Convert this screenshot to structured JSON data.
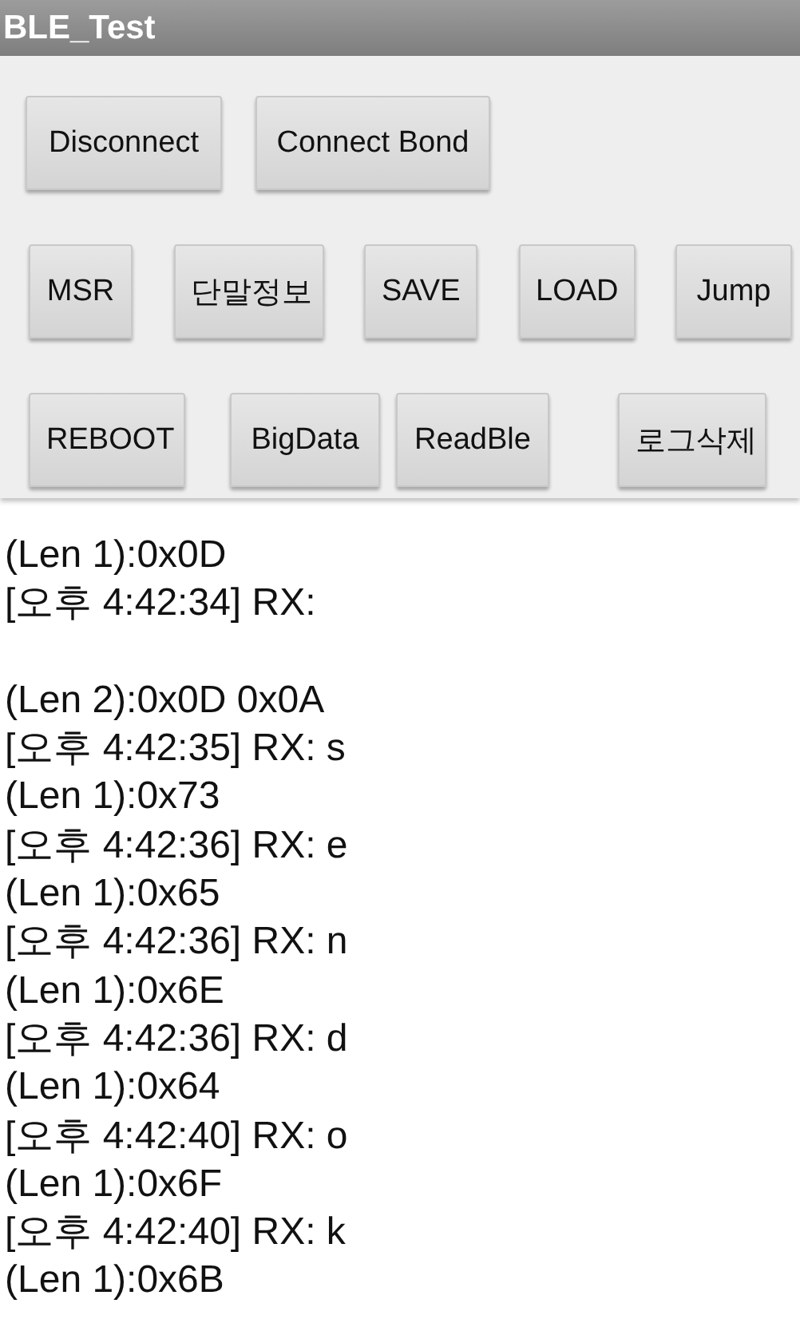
{
  "window": {
    "title": "BLE_Test"
  },
  "button_rows": [
    {
      "buttons": [
        "Disconnect",
        "Connect Bond"
      ]
    },
    {
      "buttons": [
        "MSR",
        "단말정보",
        "SAVE",
        "LOAD",
        "Jump"
      ]
    },
    {
      "buttons": [
        "REBOOT",
        "BigData",
        "ReadBle",
        "로그삭제"
      ]
    }
  ],
  "log_lines": [
    {
      "text": "(Len 1):0x0D",
      "blank_after": false
    },
    {
      "text": "[오후 4:42:34] RX:",
      "blank_after": true
    },
    {
      "text": "(Len 2):0x0D 0x0A",
      "blank_after": false
    },
    {
      "text": "[오후 4:42:35] RX: s",
      "blank_after": false
    },
    {
      "text": "(Len 1):0x73",
      "blank_after": false
    },
    {
      "text": "[오후 4:42:36] RX: e",
      "blank_after": false
    },
    {
      "text": "(Len 1):0x65",
      "blank_after": false
    },
    {
      "text": "[오후 4:42:36] RX: n",
      "blank_after": false
    },
    {
      "text": "(Len 1):0x6E",
      "blank_after": false
    },
    {
      "text": "[오후 4:42:36] RX: d",
      "blank_after": false
    },
    {
      "text": "(Len 1):0x64",
      "blank_after": false
    },
    {
      "text": "[오후 4:42:40] RX: o",
      "blank_after": false
    },
    {
      "text": "(Len 1):0x6F",
      "blank_after": false
    },
    {
      "text": "[오후 4:42:40] RX: k",
      "blank_after": false
    },
    {
      "text": "(Len 1):0x6B",
      "blank_after": false
    }
  ]
}
